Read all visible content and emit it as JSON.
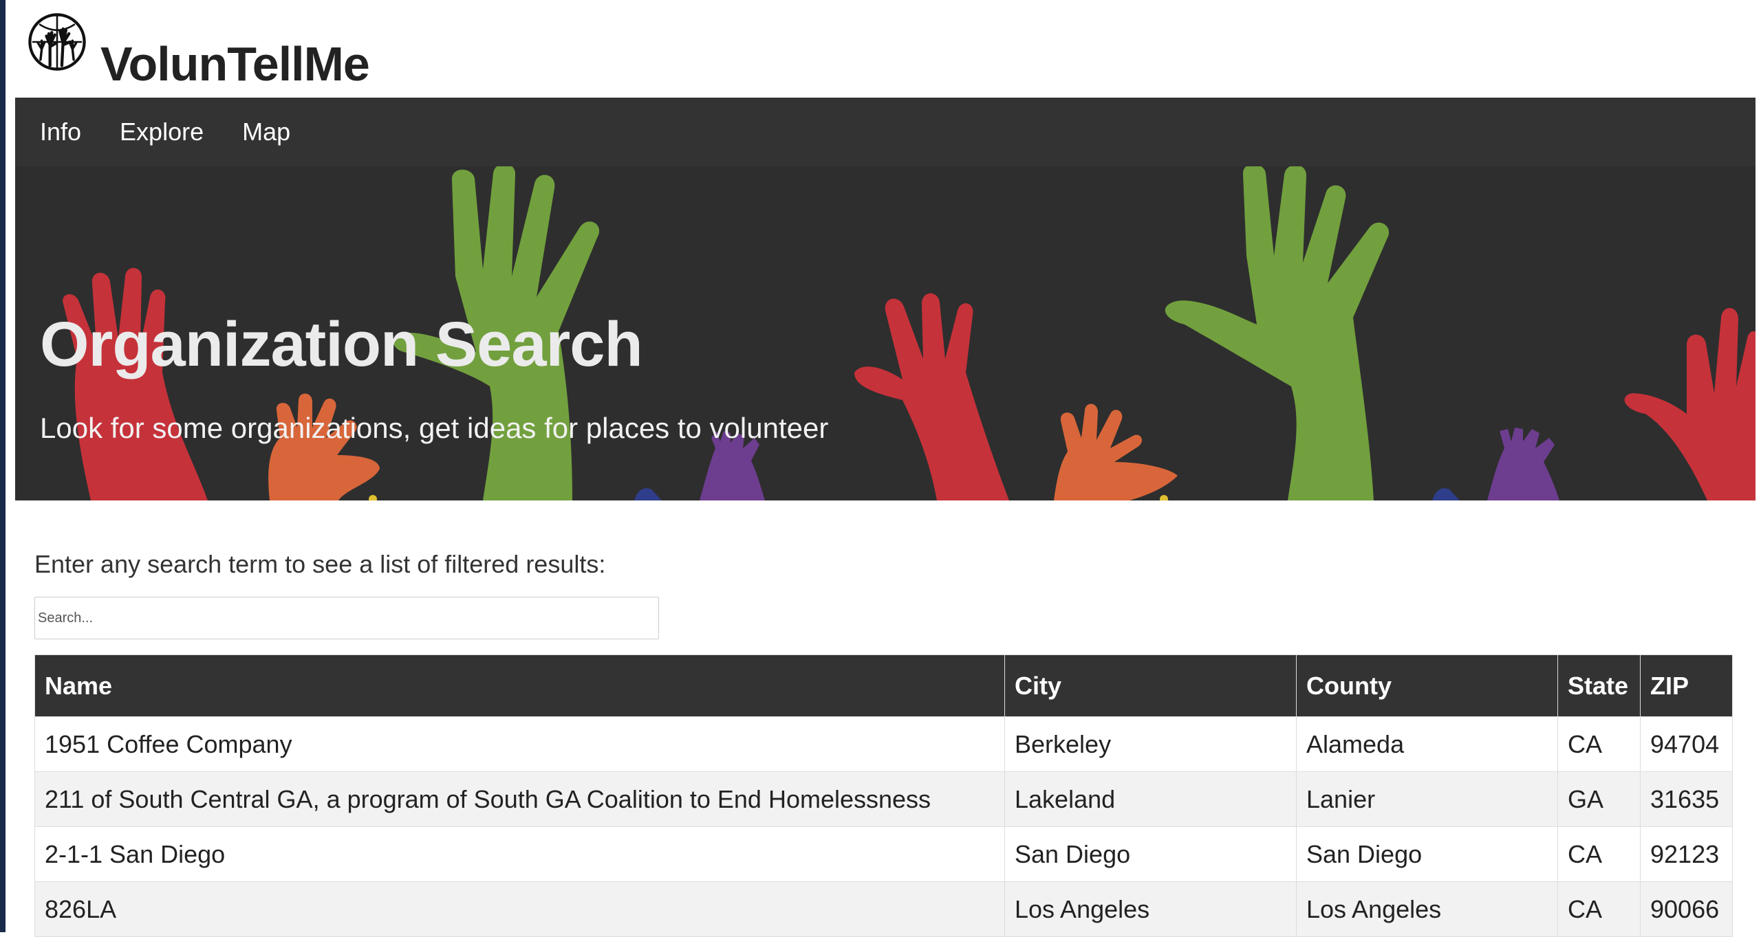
{
  "brand": {
    "title": "VolunTellMe",
    "logo_icon": "raised-hands-globe-icon"
  },
  "nav": {
    "items": [
      {
        "label": "Info"
      },
      {
        "label": "Explore"
      },
      {
        "label": "Map"
      }
    ]
  },
  "hero": {
    "title": "Organization Search",
    "subtitle": "Look for some organizations, get ideas for places to volunteer",
    "background_icon": "raised-hands-illustration",
    "colors": {
      "background": "#2e2e2e",
      "green": "#72a03e",
      "red": "#c6323a",
      "orange": "#d8663a",
      "purple": "#6d3d8f",
      "blue": "#2f3e8a",
      "yellow": "#e0c030"
    }
  },
  "search": {
    "prompt": "Enter any search term to see a list of filtered results:",
    "placeholder": "Search...",
    "value": ""
  },
  "table": {
    "headers": [
      "Name",
      "City",
      "County",
      "State",
      "ZIP"
    ],
    "rows": [
      [
        "1951 Coffee Company",
        "Berkeley",
        "Alameda",
        "CA",
        "94704"
      ],
      [
        "211 of South Central GA, a program of South GA Coalition to End Homelessness",
        "Lakeland",
        "Lanier",
        "GA",
        "31635"
      ],
      [
        "2-1-1 San Diego",
        "San Diego",
        "San Diego",
        "CA",
        "92123"
      ],
      [
        "826LA",
        "Los Angeles",
        "Los Angeles",
        "CA",
        "90066"
      ]
    ]
  },
  "theme": {
    "navbar_bg": "#333333",
    "table_header_bg": "#333333",
    "stripe_bg": "#f2f2f2"
  }
}
